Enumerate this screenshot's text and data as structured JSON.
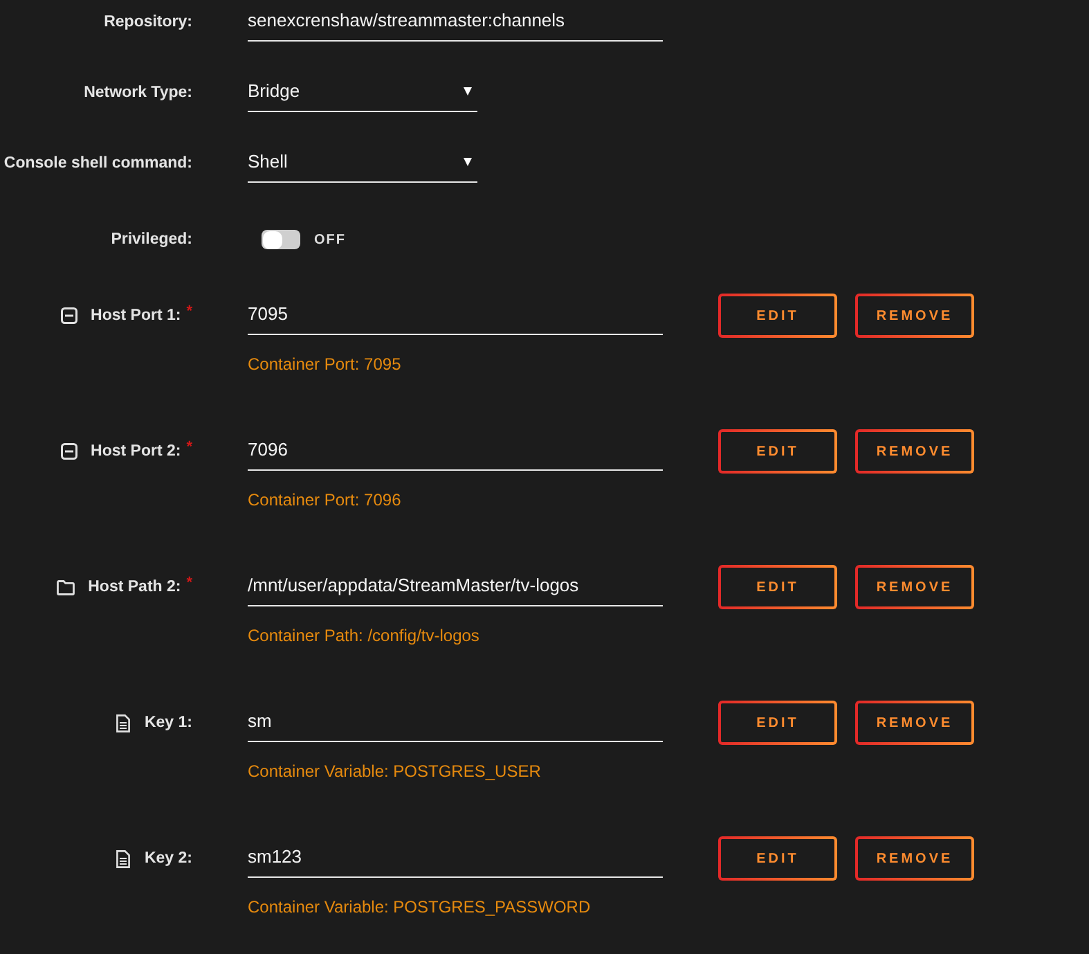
{
  "settings": [
    {
      "kind": "text",
      "label": "Repository:",
      "value": "senexcrenshaw/streammaster:channels"
    },
    {
      "kind": "select",
      "label": "Network Type:",
      "value": "Bridge"
    },
    {
      "kind": "select",
      "label": "Console shell command:",
      "value": "Shell"
    },
    {
      "kind": "toggle",
      "label": "Privileged:",
      "on": false,
      "state_label": "OFF"
    }
  ],
  "config_items": [
    {
      "kind": "port",
      "label": "Host Port 1:",
      "required_mark": "*",
      "value": "7095",
      "description": "Container Port: 7095",
      "buttons": [
        "EDIT",
        "REMOVE"
      ]
    },
    {
      "kind": "port",
      "label": "Host Port 2:",
      "required_mark": "*",
      "value": "7096",
      "description": "Container Port: 7096",
      "buttons": [
        "EDIT",
        "REMOVE"
      ]
    },
    {
      "kind": "path",
      "label": "Host Path 2:",
      "required_mark": "*",
      "value": "/mnt/user/appdata/StreamMaster/tv-logos",
      "description": "Container Path: /config/tv-logos",
      "buttons": [
        "EDIT",
        "REMOVE"
      ]
    },
    {
      "kind": "variable",
      "label": "Key 1:",
      "value": "sm",
      "description": "Container Variable: POSTGRES_USER",
      "buttons": [
        "EDIT",
        "REMOVE"
      ]
    },
    {
      "kind": "variable",
      "label": "Key 2:",
      "value": "sm123",
      "description": "Container Variable: POSTGRES_PASSWORD",
      "buttons": [
        "EDIT",
        "REMOVE"
      ]
    }
  ]
}
